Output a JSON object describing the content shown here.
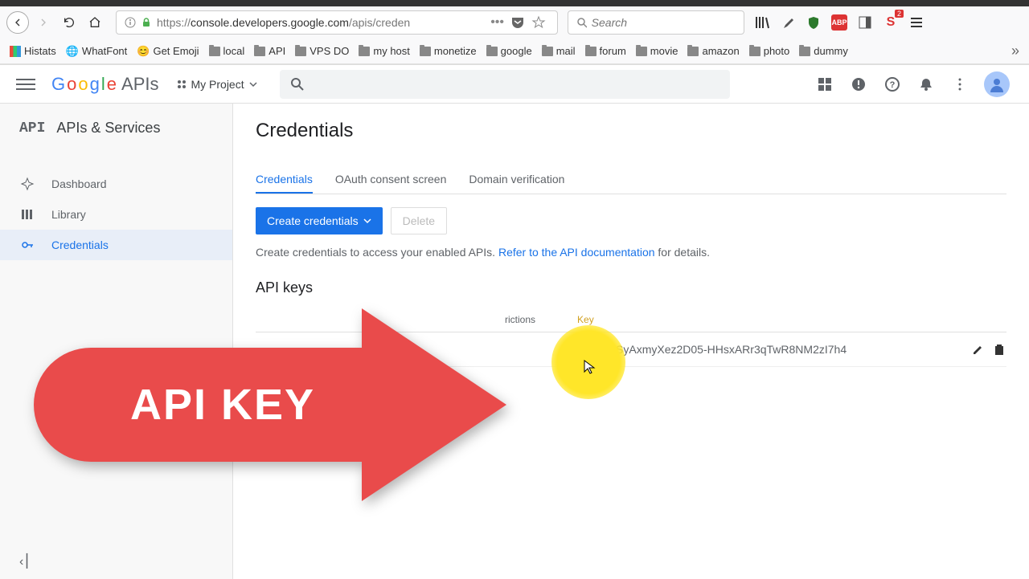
{
  "browser": {
    "url_prefix": "https://",
    "url_domain": "console.developers.google.com",
    "url_path": "/apis/creden",
    "search_placeholder": "Search"
  },
  "bookmarks": [
    "Histats",
    "WhatFont",
    "Get Emoji",
    "local",
    "API",
    "VPS DO",
    "my host",
    "monetize",
    "google",
    "mail",
    "forum",
    "movie",
    "amazon",
    "photo",
    "dummy"
  ],
  "header": {
    "logo_text": "APIs",
    "project": "My Project"
  },
  "sidebar": {
    "title": "APIs & Services",
    "items": [
      {
        "label": "Dashboard"
      },
      {
        "label": "Library"
      },
      {
        "label": "Credentials"
      }
    ]
  },
  "page": {
    "title": "Credentials",
    "tabs": [
      "Credentials",
      "OAuth consent screen",
      "Domain verification"
    ],
    "create_btn": "Create credentials",
    "delete_btn": "Delete",
    "help_pre": "Create credentials to access your enabled APIs. ",
    "help_link": "Refer to the API documentation",
    "help_post": " for details.",
    "section": "API keys",
    "th_restrictions": "rictions",
    "th_key": "Key",
    "api_key": "AIzaSyAxmyXez2D05-HHsxARr3qTwR8NM2zI7h4"
  },
  "annotation": {
    "text": "API KEY"
  },
  "notif_badge": "2"
}
